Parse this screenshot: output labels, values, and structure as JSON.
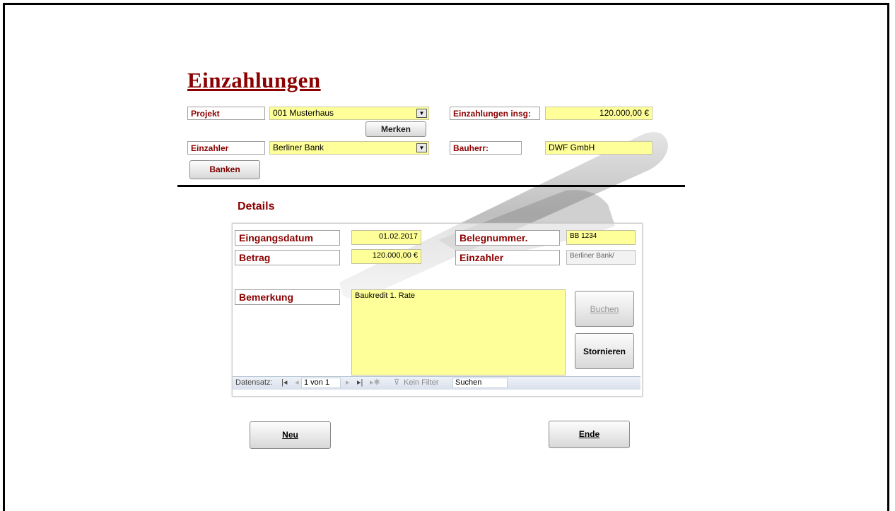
{
  "title": "Einzahlungen",
  "header": {
    "projekt_label": "Projekt",
    "projekt_value": "001 Musterhaus",
    "merken_button": "Merken",
    "einzahlungen_insg_label": "Einzahlungen insg:",
    "einzahlungen_insg_value": "120.000,00 €",
    "einzahler_label": "Einzahler",
    "einzahler_value": "Berliner Bank",
    "bauherr_label": "Bauherr:",
    "bauherr_value": "DWF GmbH",
    "banken_button": "Banken"
  },
  "details": {
    "title": "Details",
    "eingangsdatum_label": "Eingangsdatum",
    "eingangsdatum_value": "01.02.2017",
    "belegnummer_label": "Belegnummer.",
    "belegnummer_value": "BB 1234",
    "betrag_label": "Betrag",
    "betrag_value": "120.000,00 €",
    "einzahler_label": "Einzahler",
    "einzahler_value": "Berliner Bank/",
    "bemerkung_label": "Bemerkung",
    "bemerkung_value": "Baukredit 1. Rate",
    "buchen_button": "Buchen",
    "stornieren_button": "Stornieren"
  },
  "navigation": {
    "datensatz_label": "Datensatz:",
    "record_position": "1 von 1",
    "filter_label": "Kein Filter",
    "search_placeholder": "Suchen"
  },
  "footer": {
    "neu_button": "Neu",
    "ende_button": "Ende"
  },
  "icons": [
    "first-record-icon",
    "prev-record-icon",
    "next-record-icon",
    "last-record-icon",
    "new-record-icon",
    "filter-icon",
    "dropdown-arrow-icon"
  ]
}
